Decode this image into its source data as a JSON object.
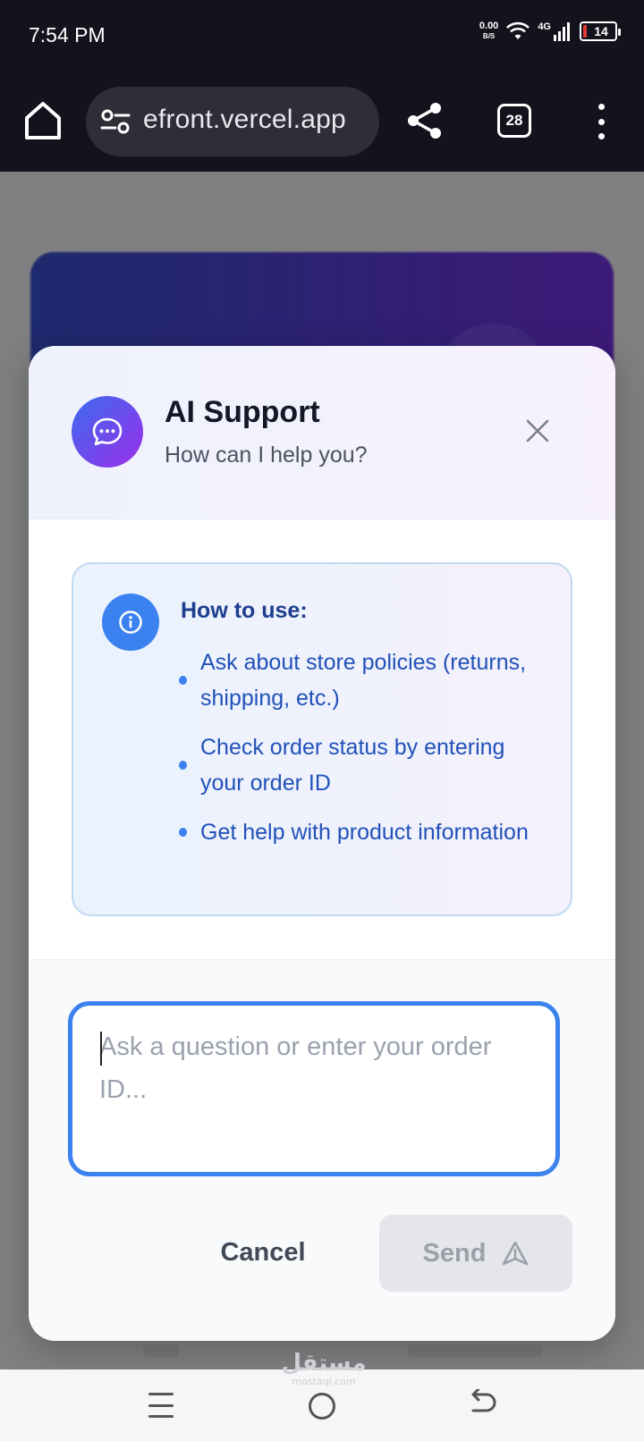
{
  "status_bar": {
    "time": "7:54 PM",
    "net_speed": "0.00",
    "net_unit": "B/S",
    "network_type": "4G",
    "battery_level": "14"
  },
  "browser": {
    "url": "efront.vercel.app",
    "tab_count": "28",
    "icons": [
      "home-icon",
      "site-settings-icon",
      "share-icon",
      "tabs-icon",
      "more-vert-icon"
    ]
  },
  "dialog": {
    "title": "AI Support",
    "subtitle": "How can I help you?",
    "info": {
      "title": "How to use:",
      "items": [
        "Ask about store policies (returns, shipping, etc.)",
        "Check order status by entering your order ID",
        "Get help with product information"
      ]
    },
    "input": {
      "value": "",
      "placeholder": "Ask a question or enter your order ID..."
    },
    "cancel_label": "Cancel",
    "send_label": "Send",
    "send_enabled": false
  },
  "nav_bar": {
    "watermark_arabic": "مستقل",
    "watermark_latin": "mostaql.com"
  },
  "colors": {
    "accent_blue": "#3b82f0",
    "avatar_gradient_start": "#3b6cf0",
    "avatar_gradient_end": "#9b2de8",
    "info_text": "#2151b9",
    "browser_bg": "#13131e"
  }
}
